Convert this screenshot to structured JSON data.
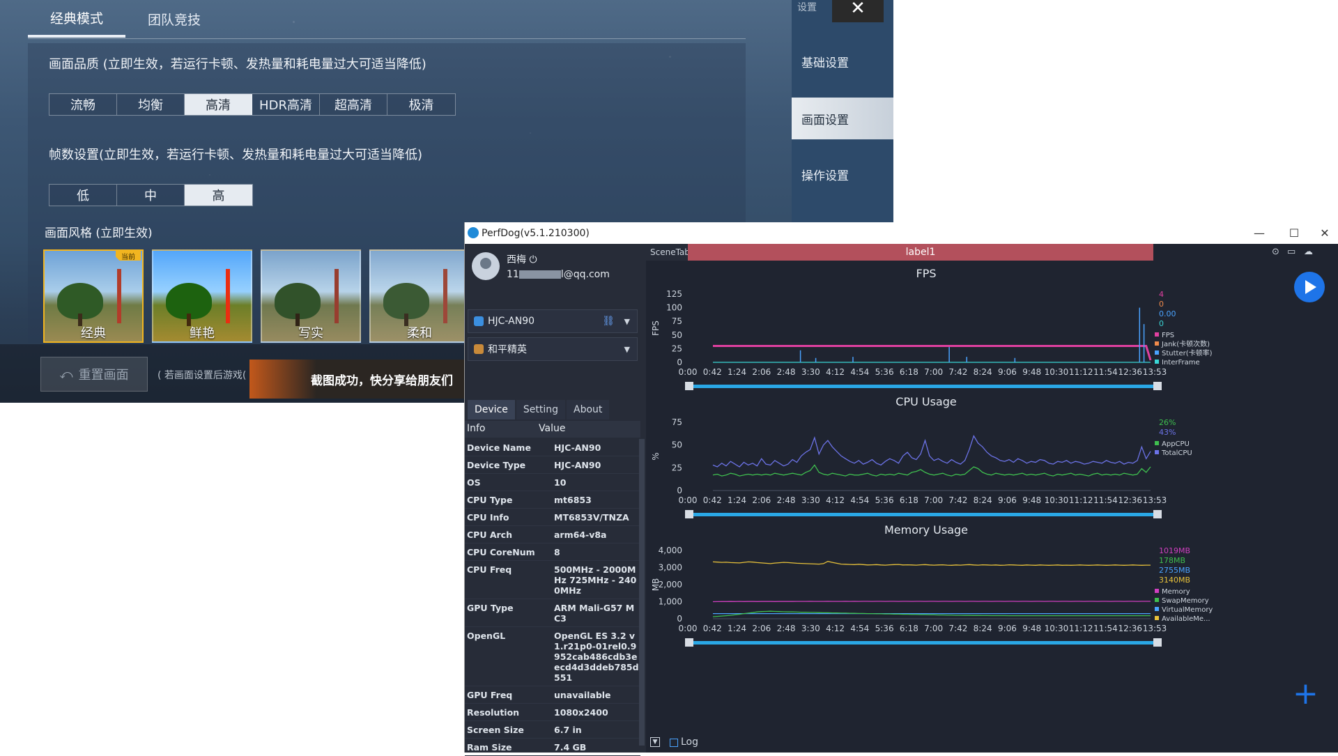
{
  "game": {
    "tabs": [
      "经典模式",
      "团队竞技"
    ],
    "quality_heading": "画面品质 (立即生效，若运行卡顿、发热量和耗电量过大可适当降低)",
    "quality_options": [
      "流畅",
      "均衡",
      "高清",
      "HDR高清",
      "超高清",
      "极清"
    ],
    "quality_selected": 2,
    "fps_heading": "帧数设置(立即生效，若运行卡顿、发热量和耗电量过大可适当降低)",
    "fps_options": [
      "低",
      "中",
      "高"
    ],
    "fps_selected": 2,
    "current_badge": "当前",
    "style_heading": "画面风格 (立即生效)",
    "styles": [
      "经典",
      "鲜艳",
      "写实",
      "柔和"
    ],
    "style_selected": 0,
    "reset_label": "重置画面",
    "reset_hint": "( 若画面设置后游戏(",
    "toast": "截图成功，快分享给朋友们",
    "side_title": "设置",
    "side_items": [
      "基础设置",
      "画面设置",
      "操作设置"
    ],
    "side_active": 1
  },
  "perfdog": {
    "title": "PerfDog(v5.1.210300)",
    "user_name": "西梅 ⏻",
    "user_email_prefix": "11",
    "user_email_suffix": "l@qq.com",
    "device": "HJC-AN90",
    "app": "和平精英",
    "tabs": [
      "Device",
      "Setting",
      "About"
    ],
    "info_headers": [
      "Info",
      "Value"
    ],
    "info": [
      {
        "k": "Device Name",
        "v": "HJC-AN90"
      },
      {
        "k": "Device Type",
        "v": "HJC-AN90"
      },
      {
        "k": "OS",
        "v": "10"
      },
      {
        "k": "CPU Type",
        "v": "mt6853"
      },
      {
        "k": "CPU Info",
        "v": "MT6853V/TNZA"
      },
      {
        "k": "CPU Arch",
        "v": "arm64-v8a"
      },
      {
        "k": "CPU CoreNum",
        "v": "8"
      },
      {
        "k": "CPU Freq",
        "v": "500MHz - 2000MHz 725MHz - 2400MHz"
      },
      {
        "k": "GPU Type",
        "v": "ARM Mali-G57 MC3"
      },
      {
        "k": "OpenGL",
        "v": "OpenGL ES 3.2 v1.r21p0-01rel0.9952cab486cdb3eecd4d3ddeb785d551"
      },
      {
        "k": "GPU Freq",
        "v": "unavailable"
      },
      {
        "k": "Resolution",
        "v": "1080x2400"
      },
      {
        "k": "Screen Size",
        "v": "6.7 in"
      },
      {
        "k": "Ram Size",
        "v": "7.4 GB"
      }
    ],
    "scene_tab": "SceneTab",
    "label": "label1",
    "log_label": "Log",
    "x_ticks": [
      "0:00",
      "0:42",
      "1:24",
      "2:06",
      "2:48",
      "3:30",
      "4:12",
      "4:54",
      "5:36",
      "6:18",
      "7:00",
      "7:42",
      "8:24",
      "9:06",
      "9:48",
      "10:30",
      "11:12",
      "11:54",
      "12:36",
      "13:53"
    ]
  },
  "chart_data": [
    {
      "type": "line",
      "title": "FPS",
      "ylabel": "FPS",
      "ylim": [
        0,
        125
      ],
      "yticks": [
        0,
        25,
        50,
        75,
        100,
        125
      ],
      "legend": [
        {
          "name": "FPS",
          "value": "4",
          "color": "#e040a0"
        },
        {
          "name": "Jank(卡顿次数)",
          "value": "0",
          "color": "#f08a4b"
        },
        {
          "name": "Stutter(卡顿率)",
          "value": "0.00",
          "color": "#4aa3ff"
        },
        {
          "name": "InterFrame",
          "value": "0",
          "color": "#3ad6d6"
        }
      ],
      "series": [
        {
          "name": "FPS",
          "values": [
            30,
            30,
            30,
            30,
            30,
            30,
            30,
            30,
            30,
            30,
            30,
            30,
            30,
            30,
            30,
            30,
            30,
            30,
            30,
            30,
            30,
            30,
            30,
            30,
            30,
            30,
            30,
            30,
            30,
            30,
            30,
            30,
            30,
            30,
            30,
            30,
            30,
            30,
            30,
            30,
            30,
            30,
            30,
            30,
            30,
            30,
            30,
            30,
            30,
            30,
            30,
            30,
            30,
            30,
            30,
            30,
            30,
            30,
            30,
            30,
            30,
            30,
            30,
            30,
            30,
            30,
            30,
            30,
            30,
            30,
            30,
            30,
            30,
            30,
            30,
            30,
            30,
            30,
            30,
            30,
            30,
            30,
            30,
            30,
            30,
            30,
            30,
            30,
            30,
            30,
            30,
            30,
            30,
            30,
            30,
            30,
            30,
            30,
            30,
            4
          ]
        },
        {
          "name": "InterFrame",
          "values": [
            0,
            0,
            0,
            0,
            0,
            0,
            0,
            0,
            0,
            0,
            0,
            0,
            0,
            0,
            0,
            0,
            0,
            0,
            0,
            0,
            0,
            0,
            0,
            0,
            0,
            0,
            0,
            0,
            0,
            0,
            0,
            0,
            0,
            0,
            0,
            0,
            0,
            0,
            0,
            0,
            0,
            0,
            0,
            0,
            0,
            0,
            0,
            0,
            0,
            0,
            0,
            0,
            0,
            0,
            0,
            0,
            0,
            0,
            0,
            0,
            0,
            0,
            0,
            0,
            0,
            0,
            0,
            0,
            0,
            0,
            0,
            0,
            0,
            0,
            0,
            0,
            0,
            0,
            0,
            0,
            0,
            0,
            0,
            0,
            0,
            0,
            0,
            0,
            0,
            0,
            0,
            0,
            0,
            0,
            0,
            0,
            0,
            0,
            0,
            0
          ]
        }
      ],
      "spikes": [
        {
          "x": 0.2,
          "y": 22
        },
        {
          "x": 0.235,
          "y": 8
        },
        {
          "x": 0.32,
          "y": 10
        },
        {
          "x": 0.54,
          "y": 28
        },
        {
          "x": 0.58,
          "y": 10
        },
        {
          "x": 0.69,
          "y": 8
        },
        {
          "x": 0.975,
          "y": 100
        },
        {
          "x": 0.985,
          "y": 70
        }
      ]
    },
    {
      "type": "line",
      "title": "CPU Usage",
      "ylabel": "%",
      "ylim": [
        0,
        75
      ],
      "yticks": [
        0,
        25,
        50,
        75
      ],
      "legend": [
        {
          "name": "AppCPU",
          "value": "26%",
          "color": "#3fbf4f"
        },
        {
          "name": "TotalCPU",
          "value": "43%",
          "color": "#6c73e8"
        }
      ],
      "series": [
        {
          "name": "AppCPU",
          "values": [
            17,
            18,
            16,
            17,
            19,
            18,
            16,
            17,
            18,
            17,
            18,
            17,
            18,
            17,
            19,
            18,
            17,
            18,
            19,
            18,
            17,
            20,
            22,
            28,
            20,
            18,
            17,
            19,
            18,
            17,
            16,
            18,
            17,
            17,
            18,
            19,
            17,
            16,
            18,
            17,
            18,
            17,
            19,
            18,
            17,
            20,
            21,
            23,
            20,
            18,
            17,
            18,
            19,
            17,
            16,
            18,
            17,
            18,
            22,
            26,
            24,
            20,
            18,
            17,
            19,
            18,
            17,
            18,
            17,
            18,
            19,
            17,
            18,
            17,
            18,
            19,
            17,
            16,
            18,
            17,
            18,
            19,
            17,
            18,
            17,
            16,
            18,
            19,
            17,
            18,
            17,
            18,
            17,
            19,
            18,
            17,
            18,
            24,
            20,
            26
          ]
        },
        {
          "name": "TotalCPU",
          "values": [
            28,
            26,
            30,
            27,
            32,
            29,
            26,
            31,
            28,
            30,
            27,
            35,
            29,
            28,
            33,
            30,
            27,
            29,
            34,
            31,
            38,
            42,
            45,
            58,
            40,
            50,
            55,
            48,
            43,
            38,
            35,
            32,
            30,
            33,
            29,
            31,
            34,
            30,
            28,
            32,
            35,
            33,
            30,
            38,
            42,
            36,
            34,
            40,
            55,
            38,
            33,
            35,
            32,
            30,
            34,
            31,
            29,
            33,
            45,
            60,
            52,
            48,
            42,
            38,
            36,
            33,
            32,
            34,
            31,
            35,
            33,
            30,
            32,
            31,
            34,
            33,
            30,
            29,
            32,
            31,
            33,
            30,
            32,
            31,
            29,
            30,
            32,
            31,
            30,
            33,
            31,
            30,
            32,
            29,
            31,
            30,
            33,
            48,
            35,
            43
          ]
        }
      ]
    },
    {
      "type": "line",
      "title": "Memory Usage",
      "ylabel": "MB",
      "ylim": [
        0,
        4000
      ],
      "yticks": [
        0,
        1000,
        2000,
        3000,
        4000
      ],
      "ytick_labels": [
        "0",
        "1,000",
        "2,000",
        "3,000",
        "4,000"
      ],
      "legend": [
        {
          "name": "Memory",
          "value": "1019MB",
          "color": "#d03fc0"
        },
        {
          "name": "SwapMemory",
          "value": "178MB",
          "color": "#3fbf4f"
        },
        {
          "name": "VirtualMemory",
          "value": "2755MB",
          "color": "#4aa3ff"
        },
        {
          "name": "AvailableMe...",
          "value": "3140MB",
          "color": "#e8c23a"
        }
      ],
      "series": [
        {
          "name": "AvailableMemory",
          "values": [
            3330,
            3320,
            3300,
            3310,
            3290,
            3280,
            3270,
            3300,
            3330,
            3320,
            3290,
            3270,
            3250,
            3230,
            3260,
            3280,
            3300,
            3290,
            3270,
            3250,
            3240,
            3230,
            3220,
            3210,
            3200,
            3230,
            3360,
            3300,
            3250,
            3200,
            3190,
            3180,
            3170,
            3190,
            3170,
            3150,
            3160,
            3170,
            3150,
            3140,
            3160,
            3170,
            3180,
            3150,
            3160,
            3150,
            3140,
            3160,
            3170,
            3150,
            3140,
            3150,
            3160,
            3140,
            3130,
            3150,
            3140,
            3160,
            3170,
            3150,
            3140,
            3160,
            3150,
            3140,
            3150,
            3130,
            3140,
            3160,
            3150,
            3140,
            3130,
            3150,
            3140,
            3130,
            3150,
            3140,
            3130,
            3140,
            3150,
            3130,
            3140,
            3130,
            3140,
            3150,
            3140,
            3130,
            3140,
            3150,
            3140,
            3130,
            3140,
            3150,
            3140,
            3130,
            3140,
            3150,
            3140,
            3130,
            3140,
            3140
          ]
        },
        {
          "name": "Memory",
          "values": [
            1000,
            1005,
            1010,
            1008,
            1012,
            1010,
            1015,
            1010,
            1012,
            1014,
            1010,
            1012,
            1015,
            1013,
            1010,
            1012,
            1015,
            1014,
            1012,
            1015,
            1018,
            1016,
            1020,
            1018,
            1015,
            1018,
            1020,
            1018,
            1016,
            1018,
            1020,
            1018,
            1019,
            1018,
            1020,
            1019,
            1018,
            1020,
            1019,
            1018,
            1020,
            1019,
            1018,
            1020,
            1019,
            1018,
            1020,
            1019,
            1018,
            1020,
            1019,
            1018,
            1020,
            1019,
            1018,
            1020,
            1019,
            1018,
            1020,
            1019,
            1018,
            1020,
            1019,
            1018,
            1020,
            1019,
            1018,
            1020,
            1019,
            1018,
            1020,
            1019,
            1018,
            1020,
            1019,
            1018,
            1020,
            1019,
            1018,
            1020,
            1019,
            1018,
            1020,
            1019,
            1018,
            1020,
            1019,
            1018,
            1020,
            1019,
            1018,
            1020,
            1019,
            1018,
            1020,
            1019,
            1018,
            1020,
            1019,
            1019
          ]
        },
        {
          "name": "VirtualMemory",
          "values": [
            300,
            300,
            300,
            302,
            300,
            301,
            300,
            302,
            300,
            301,
            300,
            302,
            300,
            301,
            300,
            302,
            300,
            301,
            300,
            302,
            300,
            301,
            300,
            302,
            300,
            301,
            300,
            302,
            300,
            301,
            300,
            302,
            300,
            301,
            300,
            302,
            300,
            301,
            300,
            302,
            300,
            301,
            300,
            302,
            300,
            301,
            300,
            302,
            300,
            301,
            300,
            302,
            300,
            301,
            300,
            302,
            300,
            301,
            300,
            302,
            300,
            301,
            300,
            302,
            300,
            301,
            300,
            302,
            300,
            301,
            300,
            302,
            300,
            301,
            300,
            302,
            300,
            301,
            300,
            302,
            300,
            301,
            300,
            302,
            300,
            301,
            300,
            302,
            300,
            301,
            300,
            302,
            300,
            301,
            300,
            302,
            300,
            301,
            300,
            300
          ]
        },
        {
          "name": "SwapMemory",
          "values": [
            120,
            140,
            160,
            180,
            200,
            230,
            260,
            300,
            330,
            360,
            400,
            420,
            430,
            440,
            430,
            420,
            410,
            400,
            400,
            390,
            380,
            380,
            370,
            370,
            360,
            350,
            350,
            340,
            340,
            330,
            330,
            320,
            320,
            310,
            310,
            300,
            300,
            290,
            290,
            280,
            280,
            270,
            270,
            260,
            260,
            250,
            250,
            240,
            240,
            230,
            230,
            220,
            220,
            210,
            210,
            200,
            200,
            195,
            195,
            190,
            190,
            188,
            186,
            185,
            184,
            183,
            182,
            181,
            180,
            180,
            180,
            179,
            179,
            179,
            178,
            178,
            178,
            178,
            178,
            178,
            178,
            178,
            178,
            178,
            178,
            178,
            178,
            178,
            178,
            178,
            178,
            178,
            178,
            178,
            178,
            178,
            178,
            178,
            178,
            178
          ]
        }
      ]
    }
  ]
}
